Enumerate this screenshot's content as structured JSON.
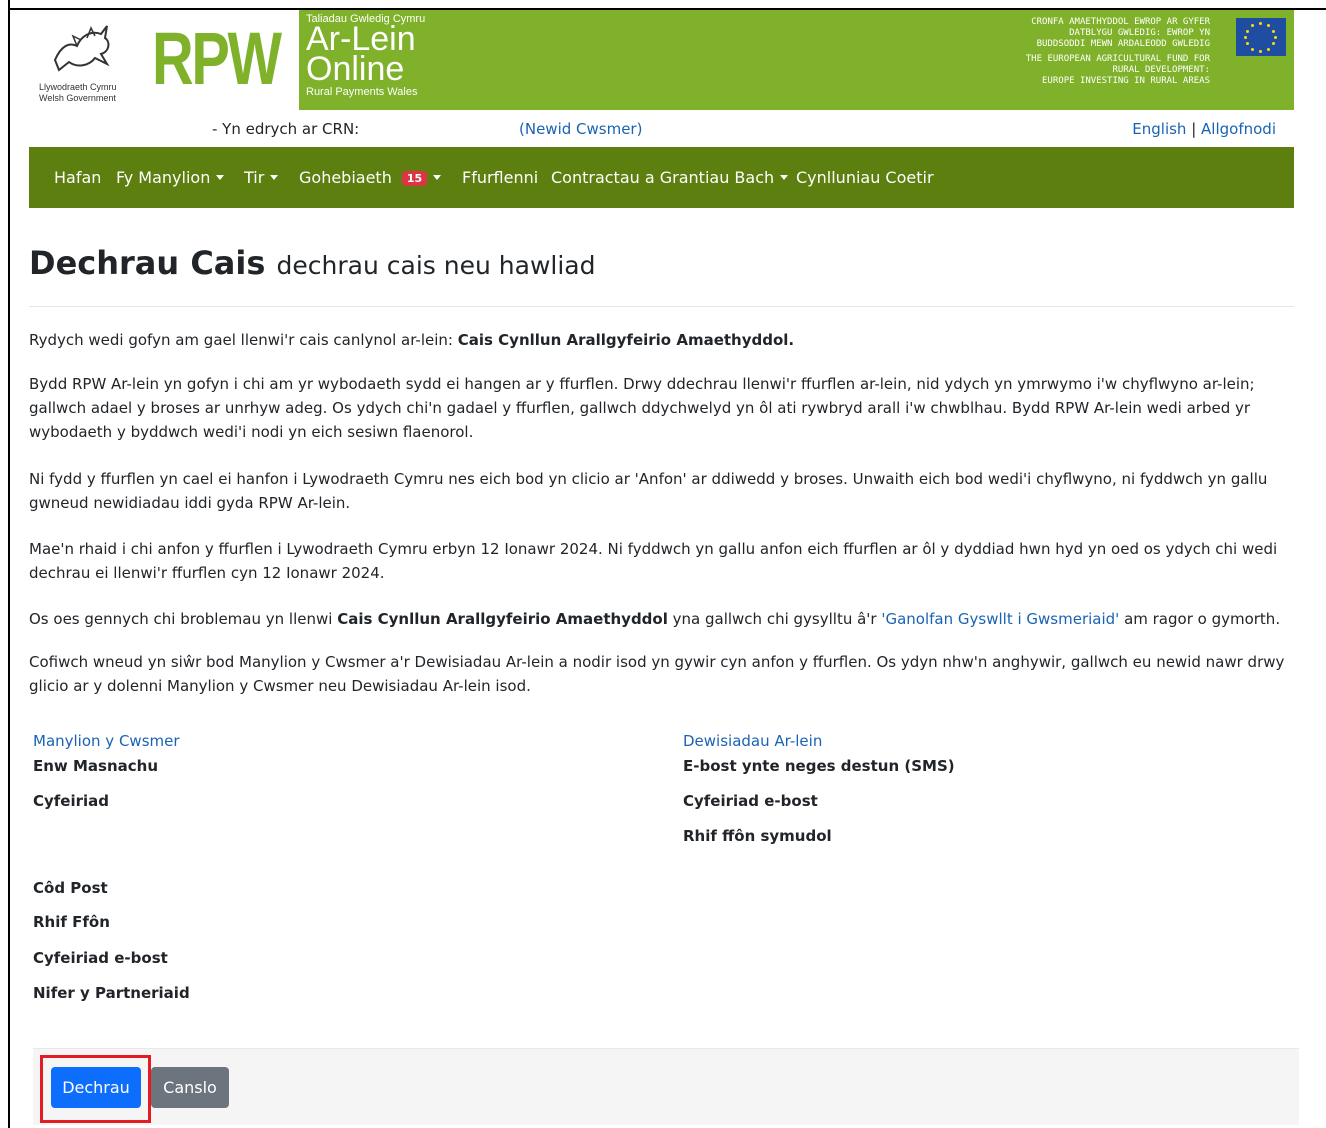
{
  "banner": {
    "wg_name_cy": "Llywodraeth Cymru",
    "wg_name_en": "Welsh Government",
    "rpw_letters": "RPW",
    "ar_small": "Taliadau Gwledig Cymru",
    "ar_line1": "Ar-Lein",
    "ar_line2": "Online",
    "rpw_wales": "Rural Payments Wales",
    "eu_cy_1": "CRONFA AMAETHYDDOL EWROP AR GYFER",
    "eu_cy_2": "DATBLYGU GWLEDIG: EWROP YN",
    "eu_cy_3": "BUDDSODDI MEWN ARDALEODD GWLEDIG",
    "eu_en_1": "THE EUROPEAN AGRICULTURAL FUND FOR",
    "eu_en_2": "RURAL DEVELOPMENT:",
    "eu_en_3": "EUROPE INVESTING IN RURAL AREAS"
  },
  "infobar": {
    "crn_text": "- Yn edrych ar CRN:",
    "change_customer": "(Newid Cwsmer)",
    "english": "English",
    "separator": " | ",
    "logout": "Allgofnodi"
  },
  "nav": {
    "home": "Hafan",
    "my_details": "Fy Manylion",
    "land": "Tir",
    "correspondence": "Gohebiaeth",
    "correspondence_badge": "15",
    "forms": "Ffurflenni",
    "contracts": "Contractau a Grantiau Bach",
    "woodland": "Cynlluniau Coetir"
  },
  "heading": {
    "title": "Dechrau Cais",
    "subtitle": "dechrau cais neu hawliad"
  },
  "paragraphs": {
    "p1_a": "Rydych wedi gofyn am gael llenwi'r cais canlynol ar-lein: ",
    "p1_b": "Cais Cynllun Arallgyfeirio Amaethyddol.",
    "p2": "Bydd RPW Ar-lein yn gofyn i chi am yr wybodaeth sydd ei hangen ar y ffurflen. Drwy ddechrau llenwi'r ffurflen ar-lein, nid ydych yn ymrwymo i'w chyflwyno ar-lein; gallwch adael y broses ar unrhyw adeg. Os ydych chi'n gadael y ffurflen, gallwch ddychwelyd yn ôl ati rywbryd arall i'w chwblhau. Bydd RPW Ar-lein wedi arbed yr wybodaeth y byddwch wedi'i nodi yn eich sesiwn flaenorol.",
    "p3": "Ni fydd y ffurflen yn cael ei hanfon i Lywodraeth Cymru nes eich bod yn clicio ar 'Anfon' ar ddiwedd y broses. Unwaith eich bod wedi'i chyflwyno, ni fyddwch yn gallu gwneud newidiadau iddi gyda RPW Ar-lein.",
    "p4": "Mae'n rhaid i chi anfon y ffurflen i Lywodraeth Cymru erbyn 12 Ionawr 2024. Ni fyddwch yn gallu anfon eich ffurflen ar ôl y dyddiad hwn hyd yn oed os ydych chi wedi dechrau ei llenwi'r ffurflen cyn 12 Ionawr 2024.",
    "p5_a": "Os oes gennych chi broblemau yn llenwi ",
    "p5_b": "Cais Cynllun Arallgyfeirio Amaethyddol",
    "p5_c": " yna gallwch chi gysylltu â'r ",
    "p5_link": "'Ganolfan Gyswllt i Gwsmeriaid'",
    "p5_d": " am ragor o gymorth.",
    "p6": "Cofiwch wneud yn siŵr bod Manylion y Cwsmer a'r Dewisiadau Ar-lein a nodir isod yn gywir cyn anfon y ffurflen. Os ydyn nhw'n anghywir, gallwch eu newid nawr drwy glicio ar y dolenni Manylion y Cwsmer neu Dewisiadau Ar-lein isod."
  },
  "customer": {
    "heading": "Manylion y Cwsmer",
    "trading_name": "Enw Masnachu",
    "address": "Cyfeiriad",
    "postcode": "Côd Post",
    "phone": "Rhif Ffôn",
    "email": "Cyfeiriad e-bost",
    "partners": "Nifer y Partneriaid"
  },
  "online_prefs": {
    "heading": "Dewisiadau Ar-lein",
    "email_or_sms": "E-bost ynte neges destun (SMS)",
    "email": "Cyfeiriad e-bost",
    "mobile": "Rhif ffôn symudol"
  },
  "buttons": {
    "start": "Dechrau",
    "cancel": "Canslo"
  },
  "colors": {
    "banner_green": "#7fb22a",
    "nav_green": "#5c7f10",
    "link_blue": "#1a63b3",
    "primary": "#0d6efd",
    "secondary": "#6c757d",
    "badge_red": "#dc3545",
    "highlight_red": "#e31b23"
  }
}
